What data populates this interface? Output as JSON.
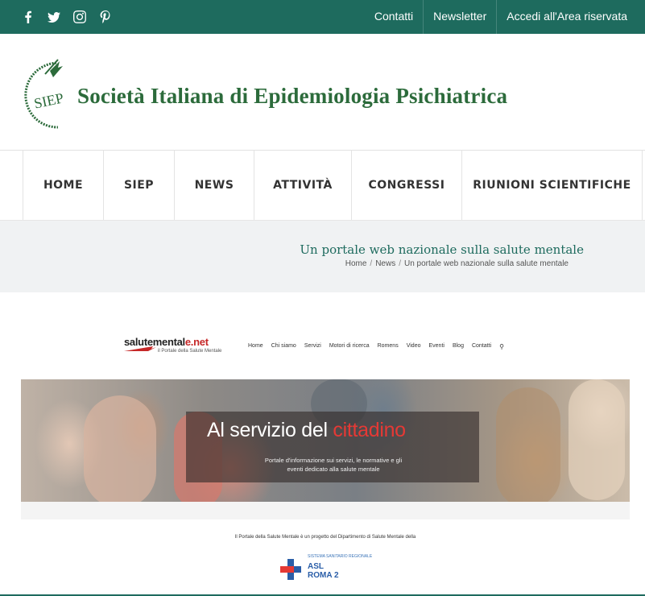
{
  "topbar": {
    "social": [
      "facebook-icon",
      "twitter-icon",
      "instagram-icon",
      "pinterest-icon"
    ],
    "links": [
      "Contatti",
      "Newsletter",
      "Accedi all'Area riservata"
    ]
  },
  "header": {
    "logo_mark": "SIEP",
    "logo_text": "Società Italiana di Epidemiologia Psichiatrica"
  },
  "nav": {
    "items": [
      "HOME",
      "SIEP",
      "NEWS",
      "ATTIVITÀ",
      "CONGRESSI",
      "RIUNIONI SCIENTIFICHE"
    ]
  },
  "titlebar": {
    "title": "Un portale web nazionale sulla salute mentale",
    "breadcrumb": [
      "Home",
      "News",
      "Un portale web nazionale sulla salute mentale"
    ]
  },
  "embed": {
    "site_name": "salutemental",
    "site_ext": "e.net",
    "tagline": "il Portale della Salute Mentale",
    "nav": [
      "Home",
      "Chi siamo",
      "Servizi",
      "Motori di ricerca",
      "Romens",
      "Video",
      "Eventi",
      "Blog",
      "Contatti"
    ],
    "hero_title": "Al servizio del ",
    "hero_title_accent": "cittadino",
    "hero_text": "Portale d'informazione sui servizi, le normative e gli eventi dedicato alla salute mentale",
    "footnote": "Il Portale della Salute Mentale è un progetto del Dipartimento di Salute Mentale della",
    "asl_system": "SISTEMA SANITARIO REGIONALE",
    "asl_line1": "ASL",
    "asl_line2": "ROMA 2"
  },
  "colors": {
    "brand": "#1e6b5e",
    "logo_green": "#2c6b3b",
    "accent_red": "#e53935"
  }
}
